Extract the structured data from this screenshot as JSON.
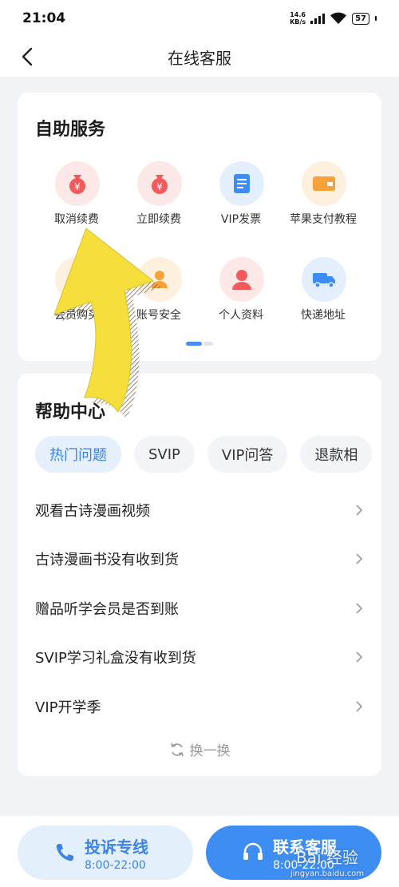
{
  "status_bar": {
    "time": "21:04",
    "net_speed_value": "14.6",
    "net_speed_unit": "KB/s",
    "battery": "57"
  },
  "nav": {
    "title": "在线客服"
  },
  "self_service": {
    "title": "自助服务",
    "items": [
      {
        "label": "取消续费",
        "icon": "money-bag-icon",
        "color": "#f15b5b"
      },
      {
        "label": "立即续费",
        "icon": "money-bag-icon",
        "color": "#f15b5b"
      },
      {
        "label": "VIP发票",
        "icon": "invoice-icon",
        "color": "#3b8cf5"
      },
      {
        "label": "苹果支付教程",
        "icon": "card-icon",
        "color": "#f6a23a"
      },
      {
        "label": "会员购买",
        "icon": "crown-icon",
        "color": "#f6a23a"
      },
      {
        "label": "账号安全",
        "icon": "user-lock-icon",
        "color": "#f6a23a"
      },
      {
        "label": "个人资料",
        "icon": "user-icon",
        "color": "#f15b5b"
      },
      {
        "label": "快递地址",
        "icon": "truck-icon",
        "color": "#3b8cf5"
      }
    ]
  },
  "help_center": {
    "title": "帮助中心",
    "tabs": [
      "热门问题",
      "SVIP",
      "VIP问答",
      "退款相"
    ],
    "faqs": [
      "观看古诗漫画视频",
      "古诗漫画书没有收到货",
      "赠品听学会员是否到账",
      "SVIP学习礼盒没有收到货",
      "VIP开学季"
    ],
    "refresh_label": "换一换"
  },
  "bottom": {
    "complaint": {
      "label": "投诉专线",
      "hours": "8:00-22:00"
    },
    "contact": {
      "label": "联系客服",
      "hours": "8:00-22:00"
    }
  },
  "watermark": {
    "text": "Bai 经验",
    "sub": "jingyan.baidu.com"
  },
  "colors": {
    "accent": "#3d8df2",
    "background": "#f2f3f7",
    "arrow": "#f6df3c"
  }
}
